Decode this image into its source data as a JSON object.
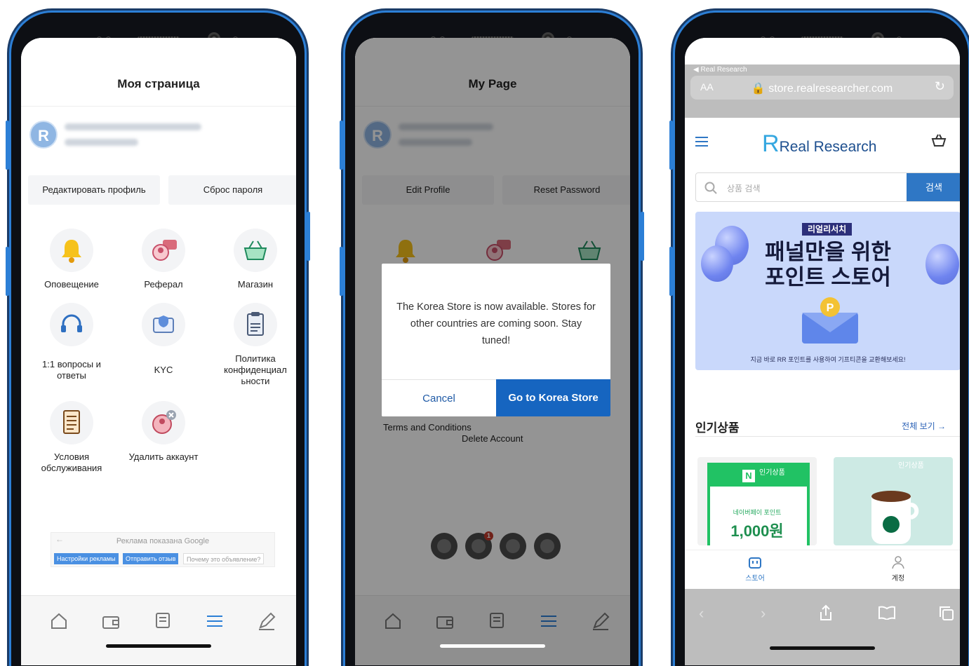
{
  "colors": {
    "accent": "#2c7fd6",
    "store_blue": "#1665c0",
    "brand": "#35a7e0"
  },
  "phone1": {
    "title": "Моя страница",
    "edit_profile": "Редактировать профиль",
    "reset_password": "Сброс пароля",
    "grid": [
      {
        "icon": "bell-icon",
        "label": "Оповещение"
      },
      {
        "icon": "referral-icon",
        "label": "Реферал"
      },
      {
        "icon": "basket-icon",
        "label": "Магазин"
      },
      {
        "icon": "headset-icon",
        "label": "1:1 вопросы и ответы"
      },
      {
        "icon": "id-card-icon",
        "label": "KYC"
      },
      {
        "icon": "clipboard-icon",
        "label": "Политика конфиденциальности",
        "display": "Политика конфиденциал ьности"
      },
      {
        "icon": "document-icon",
        "label": "Условия обслуживания"
      },
      {
        "icon": "delete-user-icon",
        "label": "Удалить аккаунт"
      }
    ],
    "ad": {
      "notice": "Реклама показана Google",
      "settings": "Настройки рекламы",
      "feedback": "Отправить отзыв",
      "why": "Почему это объявление?"
    },
    "nav": [
      "home-icon",
      "wallet-icon",
      "survey-icon",
      "menu-icon",
      "edit-icon"
    ]
  },
  "phone2": {
    "title": "My Page",
    "edit_profile": "Edit Profile",
    "reset_password": "Reset Password",
    "modal_message": "The Korea Store is now available. Stores for other countries are coming soon. Stay tuned!",
    "cancel": "Cancel",
    "go": "Go to Korea Store",
    "terms": "Terms and Conditions",
    "delete_account": "Delete Account",
    "badge_count": "1"
  },
  "phone3": {
    "back_label": "◀ Real Research",
    "aa": "AA",
    "url": "store.realresearcher.com",
    "logo_text": "Real Research",
    "search_placeholder": "상품 검색",
    "search_button": "검색",
    "banner_tag": "리얼리서치",
    "banner_line1": "패널만을 위한",
    "banner_line2": "포인트 스토어",
    "banner_sub": "지금 바로 RR 포인트를 사용하여 기프티콘을 교환해보세요!",
    "popular": "인기상품",
    "view_all": "전체 보기 →",
    "card1_badge": "인기상품",
    "card1_name": "네이버페이 포인트",
    "card1_price": "1,000원",
    "card2_badge": "인기상품",
    "tab_store": "스토어",
    "tab_account": "계정"
  }
}
